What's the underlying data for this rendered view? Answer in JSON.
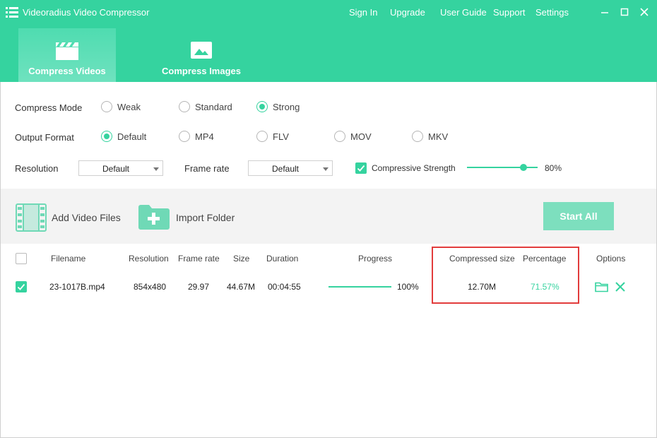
{
  "app": {
    "title": "Videoradius Video Compressor"
  },
  "menu": [
    "Sign In",
    "Upgrade",
    "User Guide",
    "Support",
    "Settings"
  ],
  "tabs": [
    {
      "label": "Compress Videos",
      "icon": "clapperboard-icon",
      "active": true
    },
    {
      "label": "Compress Images",
      "icon": "image-icon",
      "active": false
    }
  ],
  "settings": {
    "compress_mode": {
      "label": "Compress Mode",
      "options": [
        "Weak",
        "Standard",
        "Strong"
      ],
      "selected": "Strong"
    },
    "output_format": {
      "label": "Output Format",
      "options": [
        "Default",
        "MP4",
        "FLV",
        "MOV",
        "MKV"
      ],
      "selected": "Default"
    },
    "resolution": {
      "label": "Resolution",
      "value": "Default"
    },
    "frame_rate": {
      "label": "Frame rate",
      "value": "Default"
    },
    "compressive_strength": {
      "label": "Compressive Strength",
      "checked": true,
      "value_text": "80%",
      "value": 0.8
    }
  },
  "toolbar": {
    "add_files": "Add Video Files",
    "import_folder": "Import Folder",
    "start_all": "Start All"
  },
  "table": {
    "headers": [
      "Filename",
      "Resolution",
      "Frame rate",
      "Size",
      "Duration",
      "Progress",
      "Compressed size",
      "Percentage",
      "Options"
    ],
    "rows": [
      {
        "checked": true,
        "filename": "23-1017B.mp4",
        "resolution": "854x480",
        "frame_rate": "29.97",
        "size": "44.67M",
        "duration": "00:04:55",
        "progress_text": "100%",
        "progress": 1.0,
        "compressed_size": "12.70M",
        "percentage": "71.57%"
      }
    ]
  },
  "colors": {
    "accent": "#35d39f",
    "highlight": "#e23c3c"
  }
}
